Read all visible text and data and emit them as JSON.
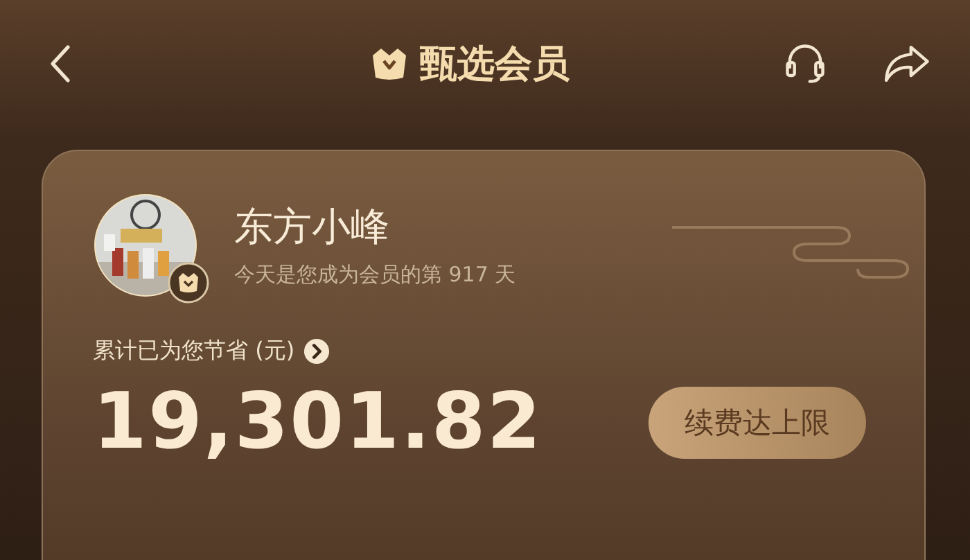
{
  "header": {
    "title": "甄选会员"
  },
  "member": {
    "name": "东方小峰",
    "days_text": "今天是您成为会员的第 917 天"
  },
  "savings": {
    "label": "累计已为您节省 (元)",
    "amount": "19,301.82"
  },
  "renew_button": {
    "label": "续费达上限"
  }
}
